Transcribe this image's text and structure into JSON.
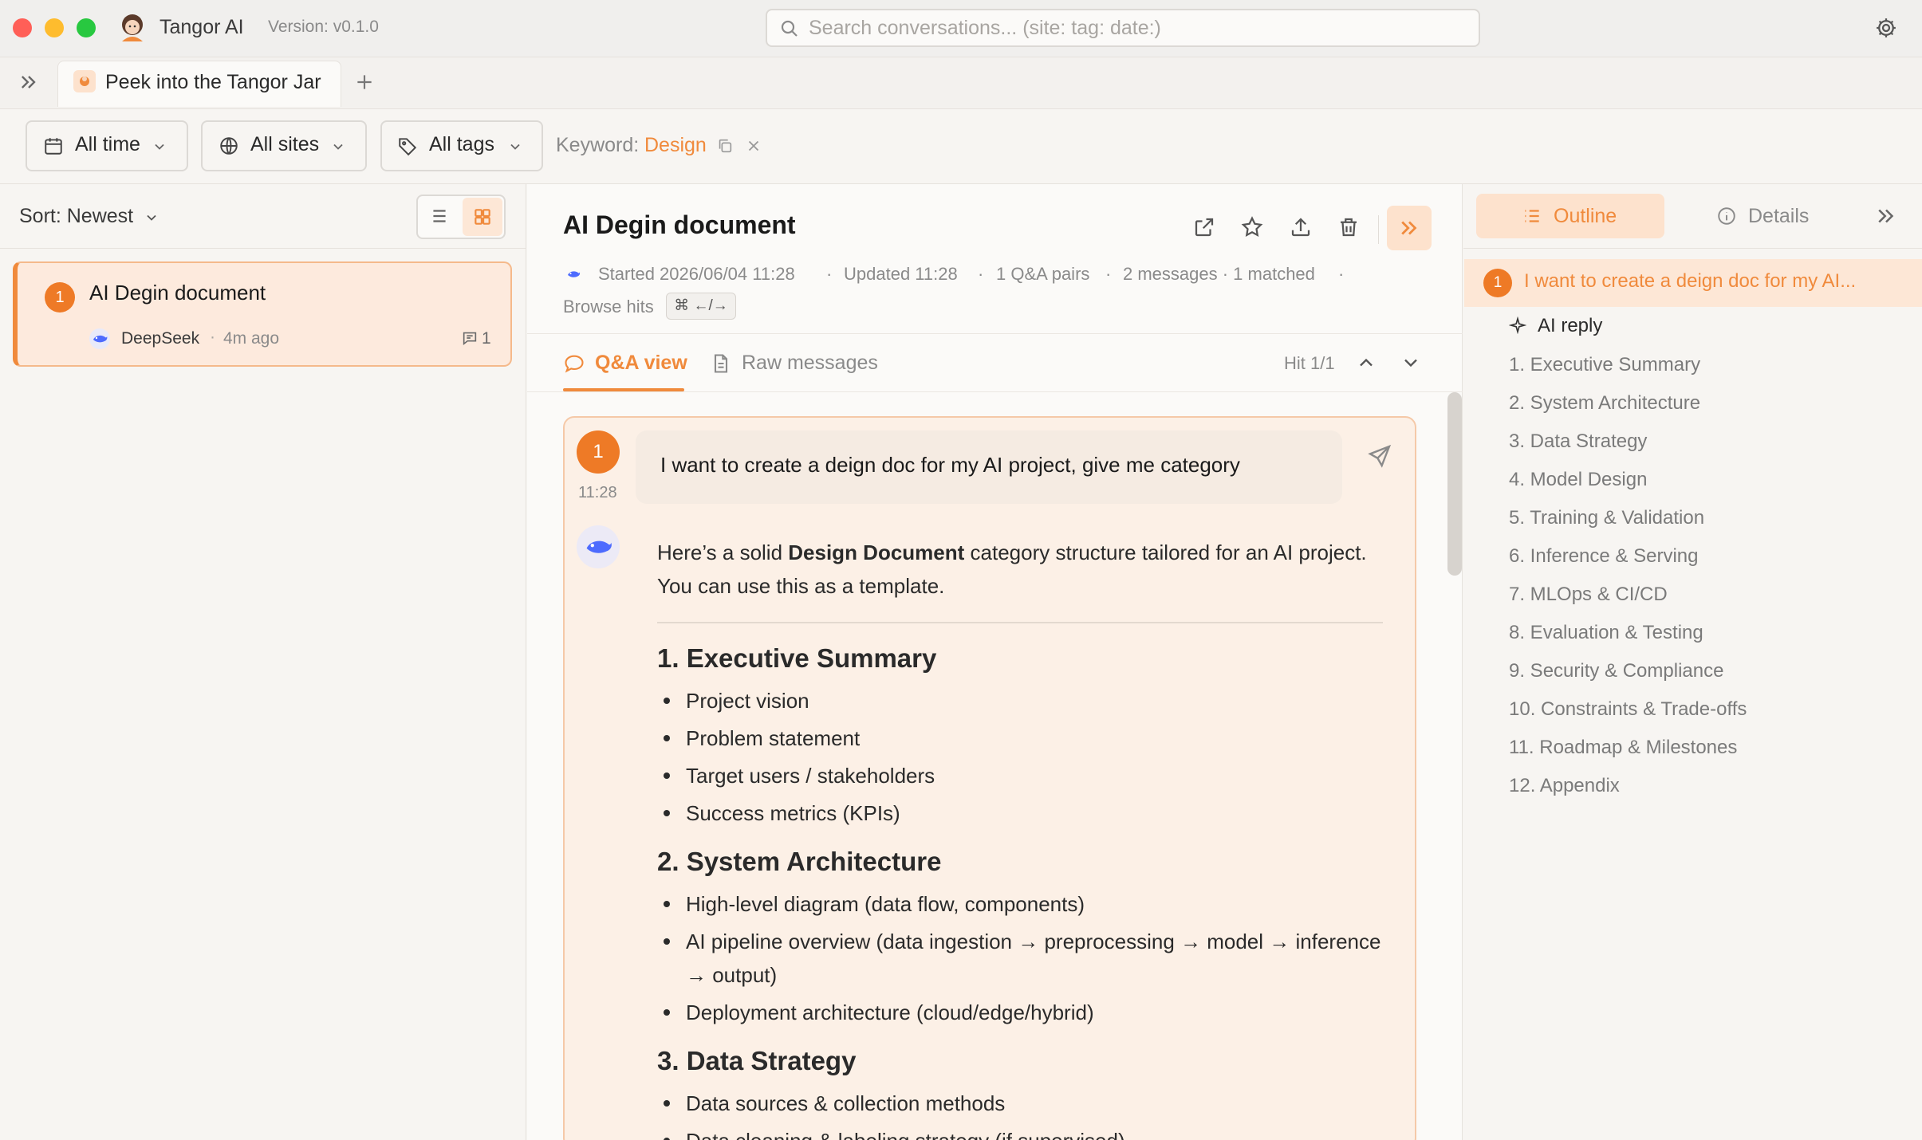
{
  "app": {
    "name": "Tangor AI",
    "version": "Version: v0.1.0"
  },
  "search": {
    "placeholder": "Search conversations... (site: tag: date:)"
  },
  "tabs": [
    {
      "label": "Peek into the Tangor Jar"
    }
  ],
  "filters": {
    "time": "All time",
    "sites": "All sites",
    "tags": "All tags",
    "keyword_label": "Keyword:",
    "keyword_value": "Design"
  },
  "list": {
    "sort_label": "Sort: Newest",
    "items": [
      {
        "index": "1",
        "title": "AI Degin document",
        "source": "DeepSeek",
        "separator": "·",
        "time": "4m ago",
        "count": "1"
      }
    ]
  },
  "document": {
    "title": "AI Degin document",
    "meta": {
      "started": "Started 2026/06/04 11:28",
      "updated": "Updated 11:28",
      "pairs": "1 Q&A pairs",
      "messages": "2 messages · 1 matched",
      "browse_label": "Browse hits",
      "browse_kbd": "⌘ ←/→"
    },
    "view_tabs": {
      "qa": "Q&A view",
      "raw": "Raw messages"
    },
    "hit": "Hit 1/1",
    "question": {
      "index": "1",
      "time": "11:28",
      "text": "I want to create a deign doc for my AI project, give me category"
    },
    "answer": {
      "intro_pre": "Here’s a solid ",
      "intro_bold": "Design Document",
      "intro_post": " category structure tailored for an AI project. You can use this as a template.",
      "sections": [
        {
          "heading": "1. Executive Summary",
          "items": [
            "Project vision",
            "Problem statement",
            "Target users / stakeholders",
            "Success metrics (KPIs)"
          ]
        },
        {
          "heading": "2. System Architecture",
          "items": [
            "High-level diagram (data flow, components)",
            "AI pipeline overview (data ingestion → preprocessing → model → inference → output)",
            "Deployment architecture (cloud/edge/hybrid)"
          ]
        },
        {
          "heading": "3. Data Strategy",
          "items": [
            "Data sources & collection methods",
            "Data cleaning & labeling strategy (if supervised)"
          ]
        }
      ]
    }
  },
  "outline": {
    "tabs": {
      "outline": "Outline",
      "details": "Details"
    },
    "question": {
      "index": "1",
      "text": "I want to create a deign doc for my AI..."
    },
    "ai_reply": "AI reply",
    "items": [
      "1. Executive Summary",
      "2. System Architecture",
      "3. Data Strategy",
      "4. Model Design",
      "5. Training & Validation",
      "6. Inference & Serving",
      "7. MLOps & CI/CD",
      "8. Evaluation & Testing",
      "9. Security & Compliance",
      "10. Constraints & Trade-offs",
      "11. Roadmap & Milestones",
      "12. Appendix"
    ]
  },
  "icons": {
    "window_close": "red-circle",
    "window_min": "yellow-circle",
    "window_max": "green-circle",
    "app_logo": "avatar-girl-icon",
    "search": "search-icon",
    "settings": "gear-icon",
    "sidebar_toggle": "double-chevron-right-icon",
    "new_tab": "plus-icon",
    "calendar": "calendar-icon",
    "globe": "globe-icon",
    "tag": "tag-icon",
    "copy": "copy-icon",
    "clear": "close-icon",
    "list_view": "list-icon",
    "grid_view": "grid-icon",
    "open_external": "external-link-icon",
    "star": "star-icon",
    "export": "upload-icon",
    "delete": "trash-icon",
    "chat": "chat-bubble-icon",
    "document": "document-icon",
    "prev": "chevron-up-icon",
    "next": "chevron-down-icon",
    "send": "send-icon",
    "deepseek": "whale-icon",
    "sparkle": "sparkle-icon",
    "info": "info-icon",
    "outline": "outline-list-icon"
  },
  "colors": {
    "accent": "#f08a3c",
    "accent_soft": "#fde2cd",
    "badge": "#ee7a26",
    "close": "#ff5f57",
    "min": "#febc2e",
    "max": "#28c840"
  }
}
